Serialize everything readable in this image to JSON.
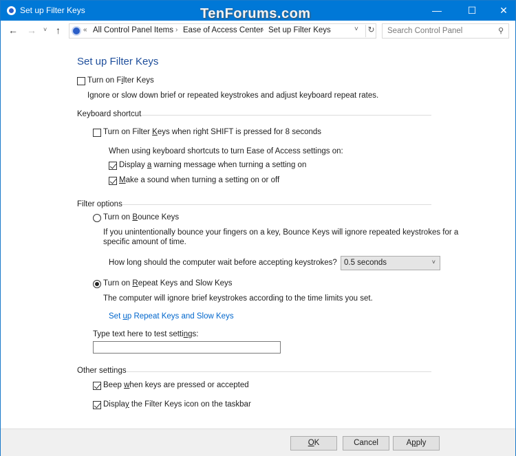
{
  "window": {
    "title": "Set up Filter Keys",
    "watermark": "TenForums.com",
    "controls": {
      "minimize": "—",
      "maximize": "☐",
      "close": "✕"
    }
  },
  "nav": {
    "back": "←",
    "forward": "→",
    "recent": "˅",
    "up": "↑",
    "overflow": "«",
    "breadcrumbs": [
      "All Control Panel Items",
      "Ease of Access Center",
      "Set up Filter Keys"
    ],
    "separator": "›",
    "dropdown": "˅",
    "refresh": "↻",
    "search_placeholder": "Search Control Panel",
    "search_value": "",
    "search_icon": "⚲"
  },
  "page": {
    "title": "Set up Filter Keys",
    "turn_on_filter_keys": {
      "pre": "Turn on F",
      "accel": "i",
      "post": "lter Keys",
      "checked": false
    },
    "description": "Ignore or slow down brief or repeated keystrokes and adjust keyboard repeat rates.",
    "keyboard_shortcut": {
      "label": "Keyboard shortcut",
      "shift_option": {
        "pre": "Turn on Filter ",
        "accel": "K",
        "post": "eys when right SHIFT is pressed for 8 seconds",
        "checked": false
      },
      "subheading": "When using keyboard shortcuts to turn Ease of Access settings on:",
      "warning_option": {
        "pre": "Display ",
        "accel": "a",
        "post": " warning message when turning a setting on",
        "checked": true
      },
      "sound_option": {
        "pre": "",
        "accel": "M",
        "post": "ake a sound when turning a setting on or off",
        "checked": true
      }
    },
    "filter_options": {
      "label": "Filter options",
      "bounce_keys": {
        "pre": "Turn on ",
        "accel": "B",
        "post": "ounce Keys",
        "selected": false
      },
      "bounce_description_1": "If you unintentionally bounce your fingers on a key, Bounce Keys will ignore repeated keystrokes for a",
      "bounce_description_2": "specific amount of time.",
      "wait_question": "How long should the computer wait before accepting keystrokes?",
      "wait_value": "0.5 seconds",
      "repeat_keys": {
        "pre": "Turn on ",
        "accel": "R",
        "post": "epeat Keys and Slow Keys",
        "selected": true
      },
      "repeat_description": "The computer will ignore brief keystrokes according to the time limits you set.",
      "setup_link": {
        "pre": "Set ",
        "accel": "u",
        "post": "p Repeat Keys and Slow Keys"
      },
      "test_label": {
        "pre": "Type text here to test setti",
        "accel": "n",
        "post": "gs:"
      },
      "test_value": ""
    },
    "other_settings": {
      "label": "Other settings",
      "beep_option": {
        "pre": "Beep ",
        "accel": "w",
        "post": "hen keys are pressed or accepted",
        "checked": true
      },
      "icon_option": {
        "pre": "Displa",
        "accel": "y",
        "post": " the Filter Keys icon on the taskbar",
        "checked": true
      }
    }
  },
  "footer": {
    "ok": {
      "pre": "",
      "accel": "O",
      "post": "K"
    },
    "cancel": "Cancel",
    "apply": {
      "pre": "A",
      "accel": "p",
      "post": "ply"
    }
  }
}
